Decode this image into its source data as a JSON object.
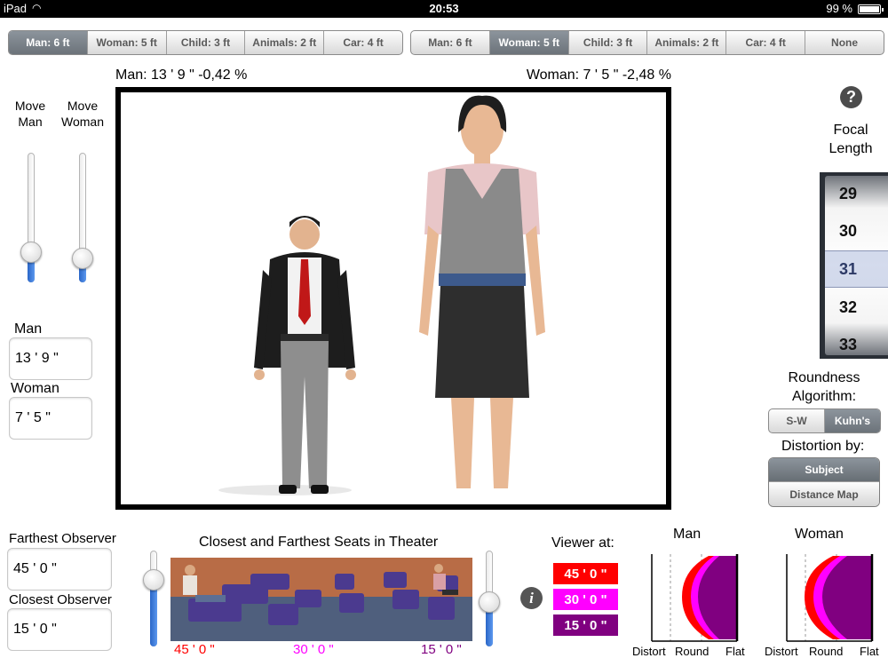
{
  "status_bar": {
    "carrier": "iPad",
    "time": "20:53",
    "battery": "99 %",
    "battery_level": 0.99
  },
  "left_segment": [
    {
      "label": "Man: 6 ft",
      "selected": true
    },
    {
      "label": "Woman: 5 ft",
      "selected": false
    },
    {
      "label": "Child: 3 ft",
      "selected": false
    },
    {
      "label": "Animals: 2 ft",
      "selected": false
    },
    {
      "label": "Car: 4 ft",
      "selected": false
    }
  ],
  "right_segment": [
    {
      "label": "Man: 6 ft",
      "selected": false
    },
    {
      "label": "Woman: 5 ft",
      "selected": true
    },
    {
      "label": "Child: 3 ft",
      "selected": false
    },
    {
      "label": "Animals: 2 ft",
      "selected": false
    },
    {
      "label": "Car: 4 ft",
      "selected": false
    },
    {
      "label": "None",
      "selected": false
    }
  ],
  "stage": {
    "man_readout": "Man: 13 ' 9 \"   -0,42 %",
    "woman_readout": "Woman: 7 ' 5 \"   -2,48 %"
  },
  "move_controls": {
    "man_label": "Move Man",
    "woman_label": "Move Woman",
    "man_value": 0.18,
    "woman_value": 0.12
  },
  "heights": {
    "man_label": "Man",
    "man_value": "13 ' 9 \"",
    "woman_label": "Woman",
    "woman_value": "7 ' 5 \""
  },
  "focal_length": {
    "label": "Focal Length",
    "options": [
      "29",
      "30",
      "31",
      "32",
      "33"
    ],
    "selected": "31"
  },
  "roundness": {
    "label": "Roundness Algorithm:",
    "options": [
      {
        "label": "S-W",
        "selected": false
      },
      {
        "label": "Kuhn's",
        "selected": true
      }
    ]
  },
  "distortion": {
    "label": "Distortion by:",
    "options": [
      {
        "label": "Subject",
        "selected": true
      },
      {
        "label": "Distance Map",
        "selected": false
      }
    ]
  },
  "observers": {
    "farthest_label": "Farthest Observer",
    "farthest_value": "45 ' 0 \"",
    "closest_label": "Closest Observer",
    "closest_value": "15 ' 0 \""
  },
  "theater": {
    "title": "Closest and Farthest Seats in Theater",
    "seat_labels": [
      {
        "text": "45 ' 0 \"",
        "color": "#ff0000"
      },
      {
        "text": "30 ' 0 \"",
        "color": "#ff00ff"
      },
      {
        "text": "15 ' 0 \"",
        "color": "#800080"
      }
    ],
    "left_slider_value": 0.75,
    "right_slider_value": 0.45
  },
  "viewer": {
    "label": "Viewer at:",
    "badges": [
      {
        "text": "45 ' 0 \"",
        "color": "#ff0000"
      },
      {
        "text": "30 ' 0 \"",
        "color": "#ff00ff"
      },
      {
        "text": "15 ' 0 \"",
        "color": "#800080"
      }
    ]
  },
  "roundness_charts": {
    "man": {
      "title": "Man",
      "axis_labels": [
        "Distort",
        "Round",
        "Flat"
      ]
    },
    "woman": {
      "title": "Woman",
      "axis_labels": [
        "Distort",
        "Round",
        "Flat"
      ]
    }
  },
  "colors": {
    "accent_blue": "#2a66c8",
    "selected_segment": "#7c848b",
    "far_red": "#ff0000",
    "mid_magenta": "#ff00ff",
    "near_purple": "#800080"
  }
}
